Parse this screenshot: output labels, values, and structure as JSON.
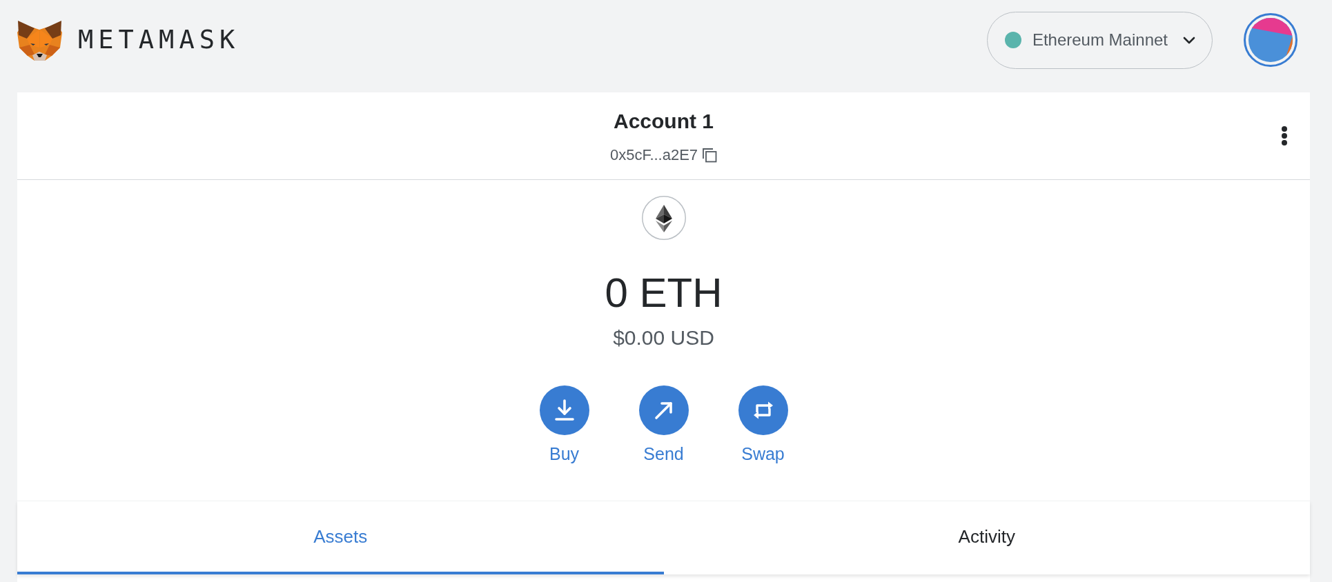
{
  "header": {
    "wordmark": "METAMASK",
    "network": {
      "name": "Ethereum Mainnet"
    }
  },
  "account": {
    "name": "Account 1",
    "address": "0x5cF...a2E7"
  },
  "balance": {
    "amount": "0 ETH",
    "fiat": "$0.00 USD"
  },
  "actions": [
    {
      "label": "Buy",
      "kind": "buy"
    },
    {
      "label": "Send",
      "kind": "send"
    },
    {
      "label": "Swap",
      "kind": "swap"
    }
  ],
  "tabs": [
    {
      "label": "Assets",
      "selected": true
    },
    {
      "label": "Activity",
      "selected": false
    }
  ]
}
